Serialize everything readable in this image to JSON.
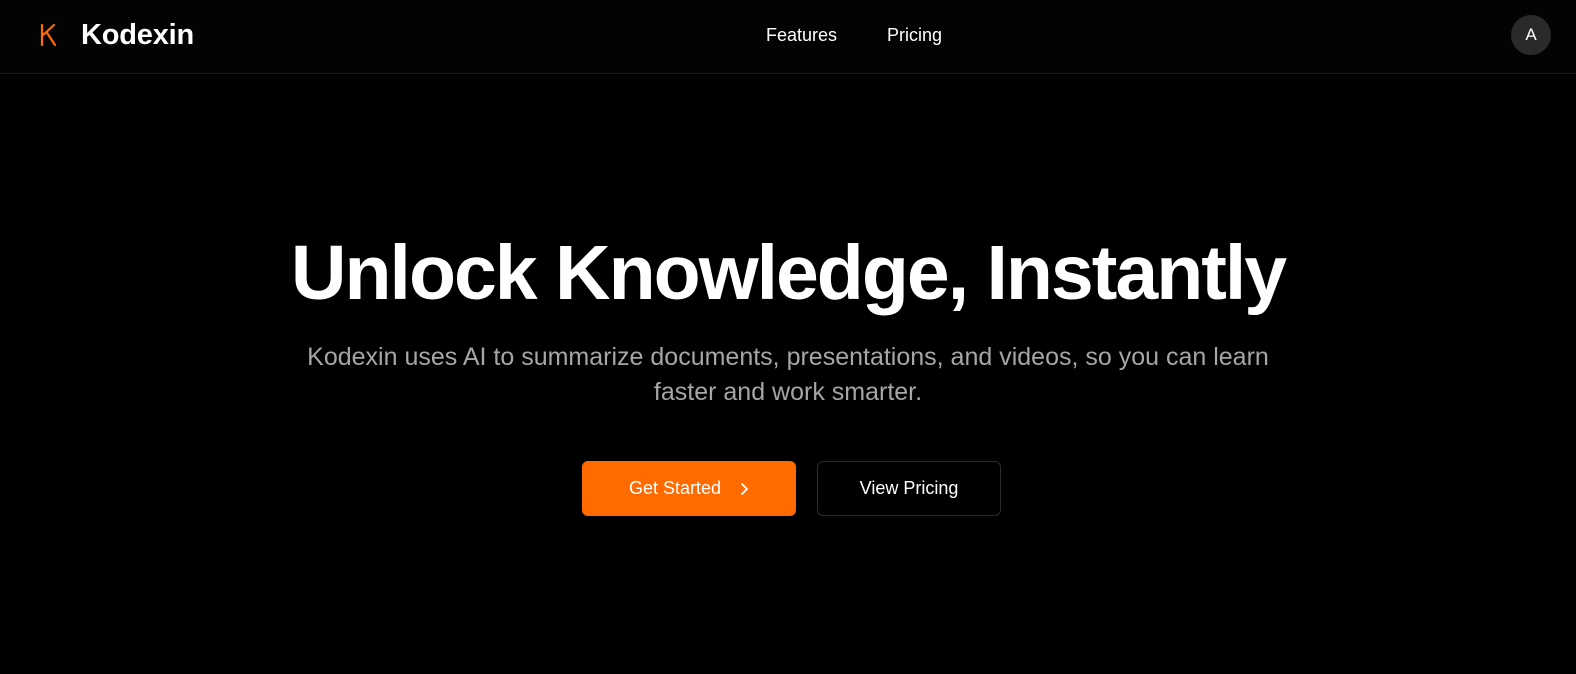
{
  "brand": {
    "logo_letter": "K",
    "name": "Kodexin",
    "logo_icon": "k-logo-icon",
    "accent_color": "#ff6b00"
  },
  "nav": {
    "items": [
      {
        "label": "Features"
      },
      {
        "label": "Pricing"
      }
    ]
  },
  "user": {
    "avatar_initial": "A"
  },
  "hero": {
    "title": "Unlock Knowledge, Instantly",
    "subtitle": "Kodexin uses AI to summarize documents, presentations, and videos, so you can learn faster and work smarter.",
    "primary_button": {
      "label": "Get Started",
      "icon": "chevron-right-icon"
    },
    "secondary_button": {
      "label": "View Pricing"
    }
  },
  "colors": {
    "background": "#000000",
    "text": "#ffffff",
    "muted_text": "#a6a6a6",
    "accent": "#ff6b00"
  }
}
